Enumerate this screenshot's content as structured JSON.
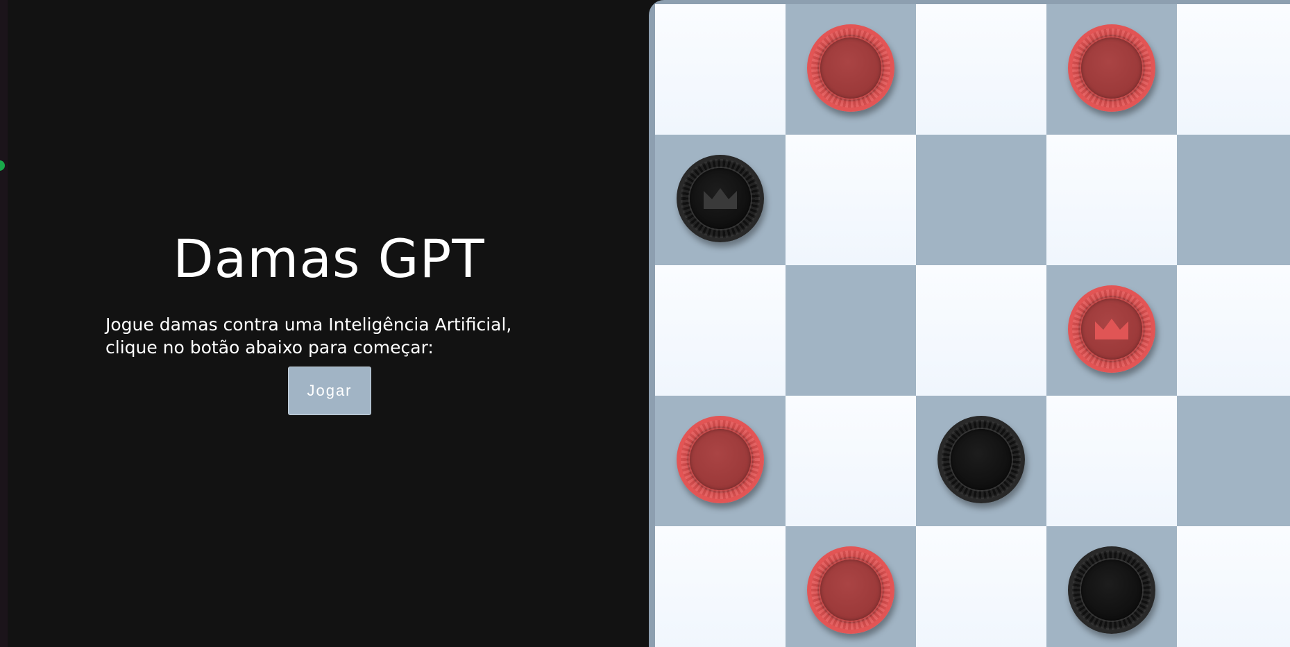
{
  "intro": {
    "title": "Damas GPT",
    "description_lines": [
      "Jogue damas contra uma Inteligência Artificial,",
      "clique no botão abaixo para começar:"
    ],
    "play_button_label": "Jogar"
  },
  "status": {
    "indicator_color": "#19a84a"
  },
  "colors": {
    "background": "#121212",
    "board_frame": "#8d9fb0",
    "dark_square": "#a1b4c4",
    "light_square": "#f4f8fd",
    "red_piece": "#e25454",
    "black_piece": "#121212",
    "button": "#a1b4c5"
  },
  "board": {
    "visible_rows": 5,
    "visible_cols": 6,
    "pieces": [
      {
        "row": 0,
        "col": 1,
        "color": "red",
        "king": false
      },
      {
        "row": 0,
        "col": 3,
        "color": "red",
        "king": false
      },
      {
        "row": 1,
        "col": 0,
        "color": "black",
        "king": true
      },
      {
        "row": 2,
        "col": 3,
        "color": "red",
        "king": true
      },
      {
        "row": 3,
        "col": 0,
        "color": "red",
        "king": false
      },
      {
        "row": 3,
        "col": 2,
        "color": "black",
        "king": false
      },
      {
        "row": 4,
        "col": 1,
        "color": "red",
        "king": false
      },
      {
        "row": 4,
        "col": 3,
        "color": "black",
        "king": false
      }
    ]
  }
}
